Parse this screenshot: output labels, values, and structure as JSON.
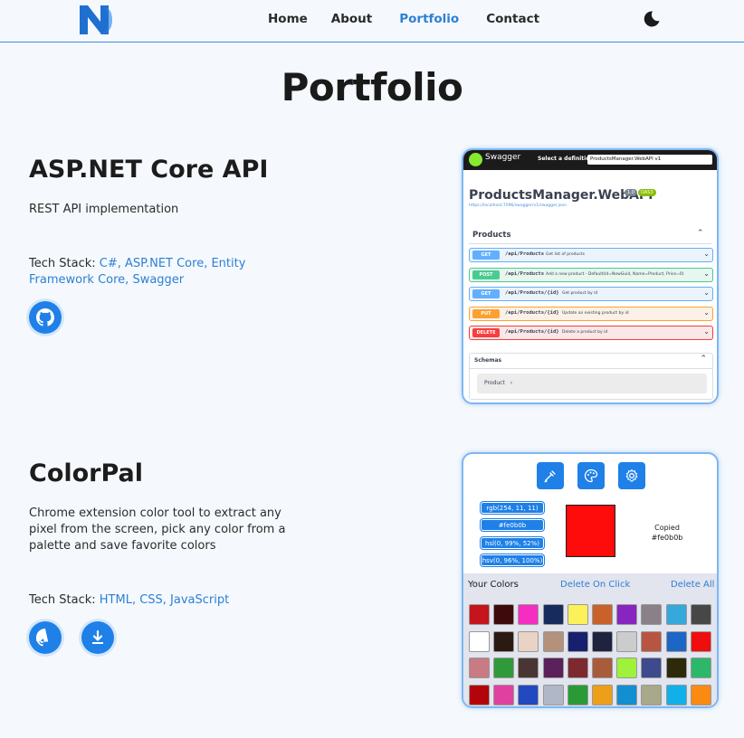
{
  "nav": {
    "items": [
      {
        "label": "Home"
      },
      {
        "label": "About"
      },
      {
        "label": "Portfolio",
        "active": true
      },
      {
        "label": "Contact"
      }
    ],
    "accent": "#2d7fd4"
  },
  "page_title": "Portfolio",
  "projects": [
    {
      "title": "ASP.NET Core API",
      "description": "REST API implementation",
      "tech_label": "Tech Stack:",
      "tech_values": "C#, ASP.NET Core, Entity Framework Core, Swagger",
      "screenshot": {
        "brand": "Swagger",
        "select_label": "Select a definition",
        "select_value": "ProductsManager.WebAPI v1",
        "api_title": "ProductsManager.WebAPI",
        "version": "1.0",
        "oas": "OAS3",
        "json_link": "https://localhost:7096/swagger/v1/swagger.json",
        "section": "Products",
        "endpoints": [
          {
            "method": "GET",
            "path": "/api/Products",
            "desc": "Get list of products",
            "color": "#61affe",
            "bg": "#ebf3fb"
          },
          {
            "method": "POST",
            "path": "/api/Products",
            "desc": "Add a new product - Default(Id=NewGuid, Name=Product, Price=0)",
            "color": "#49cc90",
            "bg": "#e8f6f0"
          },
          {
            "method": "GET",
            "path": "/api/Products/{id}",
            "desc": "Get product by id",
            "color": "#61affe",
            "bg": "#ebf3fb"
          },
          {
            "method": "PUT",
            "path": "/api/Products/{id}",
            "desc": "Update an existing product by id",
            "color": "#fca130",
            "bg": "#fbf1e6"
          },
          {
            "method": "DELETE",
            "path": "/api/Products/{id}",
            "desc": "Delete a product by id",
            "color": "#f93e3e",
            "bg": "#fae7e7"
          }
        ],
        "schemas_label": "Schemas",
        "model_label": "Product"
      }
    },
    {
      "title": "ColorPal",
      "description": "Chrome extension color tool to extract any pixel from the screen, pick any color from a palette and save favorite colors",
      "tech_label": "Tech Stack:",
      "tech_values": "HTML, CSS, JavaScript",
      "screenshot": {
        "values": [
          "rgb(254, 11, 11)",
          "#fe0b0b",
          "hsl(0, 99%, 52%)",
          "hsv(0, 96%, 100%)"
        ],
        "current_color": "#fe0b0b",
        "copied_label": "Copied",
        "copied_value": "#fe0b0b",
        "your_colors": "Your Colors",
        "delete_on_click": "Delete On Click",
        "delete_all": "Delete All",
        "palette": [
          "#c5141c",
          "#3e0a0c",
          "#f52dc0",
          "#172b5c",
          "#fbf15a",
          "#c9622a",
          "#8824c0",
          "#8a8088",
          "#35a8dc",
          "#474747",
          "#ffffff",
          "#2b1a12",
          "#e8d3c5",
          "#b3917a",
          "#17206e",
          "#1f2340",
          "#cccccc",
          "#b85442",
          "#1e66c6",
          "#f00d0d",
          "#c87b82",
          "#2e9a3a",
          "#493634",
          "#5a215a",
          "#7c2a30",
          "#a85c3c",
          "#9ef23a",
          "#3d4a8e",
          "#2d2a0a",
          "#2db76a",
          "#b3040c",
          "#e040a0",
          "#2249c0",
          "#b0b8c8",
          "#2a9a36",
          "#eca01a",
          "#138ed0",
          "#a8a88a",
          "#12b0e8",
          "#fb8a12"
        ]
      }
    }
  ]
}
